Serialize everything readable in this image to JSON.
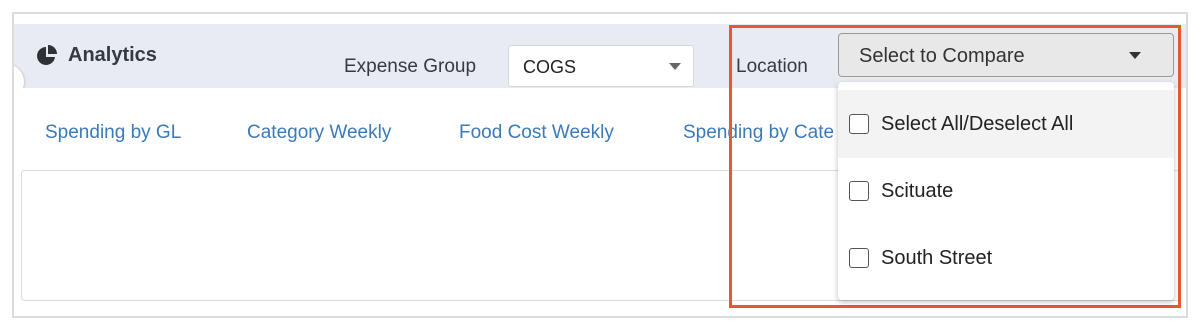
{
  "header": {
    "title": "Analytics",
    "icon": "pie-chart-icon"
  },
  "filters": {
    "expense_group_label": "Expense Group",
    "expense_group_value": "COGS",
    "location_label": "Location",
    "location_placeholder": "Select to Compare"
  },
  "tabs": [
    {
      "label": "Spending by GL"
    },
    {
      "label": "Category Weekly"
    },
    {
      "label": "Food Cost Weekly"
    },
    {
      "label": "Spending by Cate"
    }
  ],
  "location_dropdown": {
    "items": [
      {
        "label": "Select All/Deselect All",
        "checked": false
      },
      {
        "label": "Scituate",
        "checked": false
      },
      {
        "label": "South Street",
        "checked": false
      }
    ]
  },
  "colors": {
    "accent_link": "#3b7ab8",
    "highlight_border": "#e55a2b",
    "header_bg": "#e8ecf2"
  }
}
